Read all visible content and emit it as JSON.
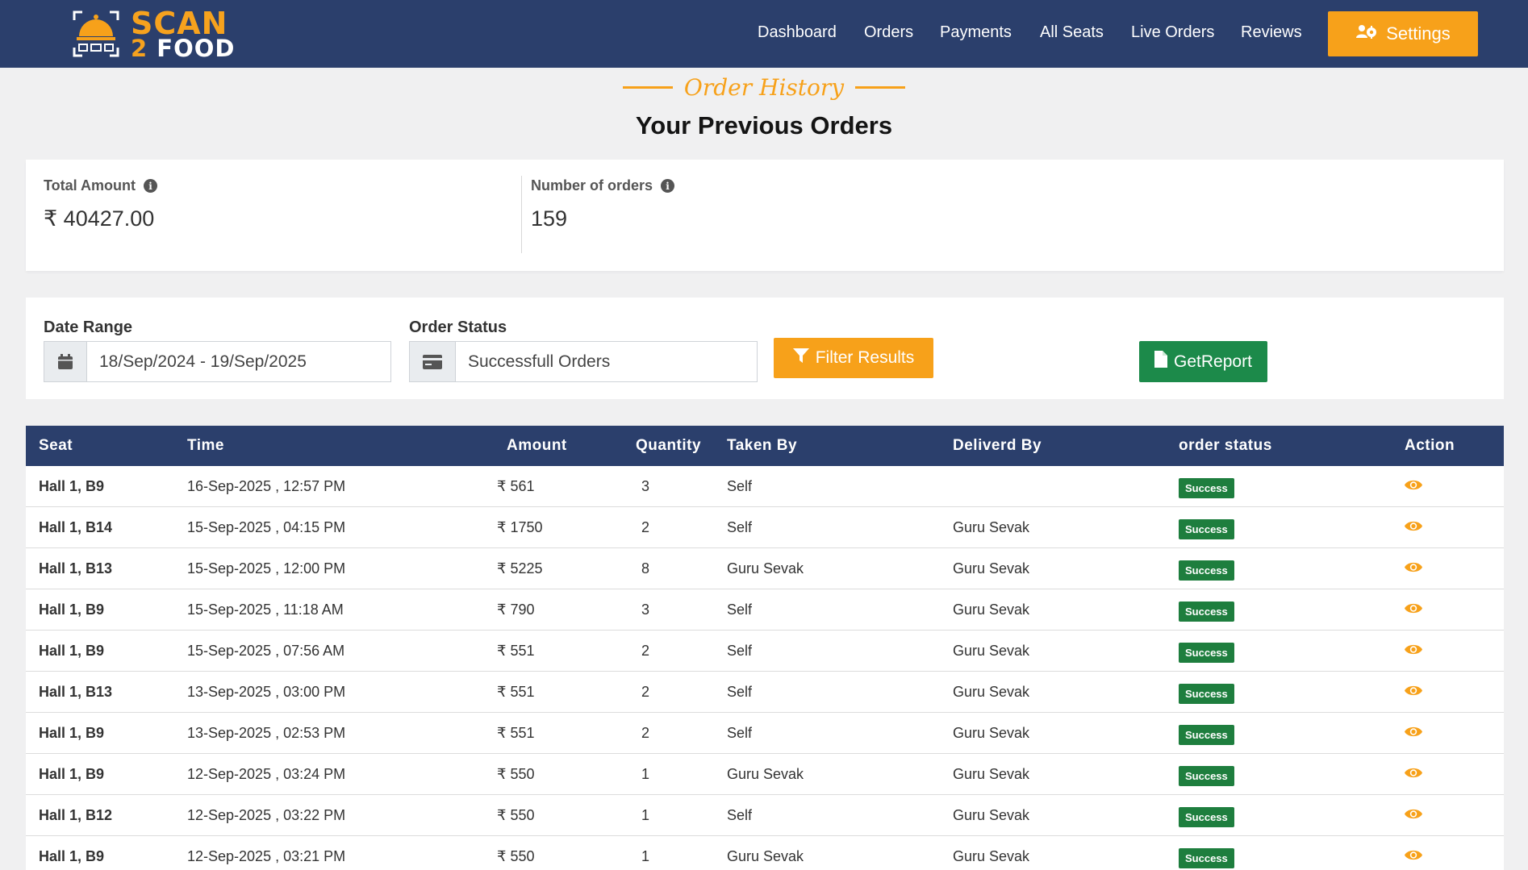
{
  "brand": {
    "line1": "SCAN",
    "line2_num": "2",
    "line2_word": "FOOD"
  },
  "nav": {
    "items": [
      "Dashboard",
      "Orders",
      "Payments",
      "All Seats",
      "Live Orders",
      "Reviews"
    ],
    "settings_label": "Settings"
  },
  "heading": {
    "kicker": "Order History",
    "title": "Your Previous Orders"
  },
  "summary": {
    "total_amount_label": "Total Amount",
    "total_amount_value": "₹ 40427.00",
    "orders_label": "Number of orders",
    "orders_value": "159"
  },
  "filters": {
    "date_label": "Date Range",
    "date_value": "18/Sep/2024 - 19/Sep/2025",
    "status_label": "Order Status",
    "status_value": "Successfull Orders",
    "filter_button": "Filter Results",
    "report_button": "GetReport"
  },
  "table": {
    "headers": [
      "Seat",
      "Time",
      "Amount",
      "Quantity",
      "Taken By",
      "Deliverd By",
      "order status",
      "Action"
    ],
    "rows": [
      {
        "seat": "Hall 1, B9",
        "time": "16-Sep-2025 , 12:57 PM",
        "amount": "₹ 561",
        "qty": "3",
        "taken": "Self",
        "delivered": "",
        "status": "Success"
      },
      {
        "seat": "Hall 1, B14",
        "time": "15-Sep-2025 , 04:15 PM",
        "amount": "₹ 1750",
        "qty": "2",
        "taken": "Self",
        "delivered": "Guru Sevak",
        "status": "Success"
      },
      {
        "seat": "Hall 1, B13",
        "time": "15-Sep-2025 , 12:00 PM",
        "amount": "₹ 5225",
        "qty": "8",
        "taken": "Guru Sevak",
        "delivered": "Guru Sevak",
        "status": "Success"
      },
      {
        "seat": "Hall 1, B9",
        "time": "15-Sep-2025 , 11:18 AM",
        "amount": "₹ 790",
        "qty": "3",
        "taken": "Self",
        "delivered": "Guru Sevak",
        "status": "Success"
      },
      {
        "seat": "Hall 1, B9",
        "time": "15-Sep-2025 , 07:56 AM",
        "amount": "₹ 551",
        "qty": "2",
        "taken": "Self",
        "delivered": "Guru Sevak",
        "status": "Success"
      },
      {
        "seat": "Hall 1, B13",
        "time": "13-Sep-2025 , 03:00 PM",
        "amount": "₹ 551",
        "qty": "2",
        "taken": "Self",
        "delivered": "Guru Sevak",
        "status": "Success"
      },
      {
        "seat": "Hall 1, B9",
        "time": "13-Sep-2025 , 02:53 PM",
        "amount": "₹ 551",
        "qty": "2",
        "taken": "Self",
        "delivered": "Guru Sevak",
        "status": "Success"
      },
      {
        "seat": "Hall 1, B9",
        "time": "12-Sep-2025 , 03:24 PM",
        "amount": "₹ 550",
        "qty": "1",
        "taken": "Guru Sevak",
        "delivered": "Guru Sevak",
        "status": "Success"
      },
      {
        "seat": "Hall 1, B12",
        "time": "12-Sep-2025 , 03:22 PM",
        "amount": "₹ 550",
        "qty": "1",
        "taken": "Self",
        "delivered": "Guru Sevak",
        "status": "Success"
      },
      {
        "seat": "Hall 1, B9",
        "time": "12-Sep-2025 , 03:21 PM",
        "amount": "₹ 550",
        "qty": "1",
        "taken": "Guru Sevak",
        "delivered": "Guru Sevak",
        "status": "Success"
      }
    ]
  },
  "colors": {
    "header_bg": "#2b3f6c",
    "accent": "#f7a11a",
    "success": "#1e7e3e",
    "report": "#1c8a4a"
  },
  "icons": {
    "settings": "users-cog-icon",
    "info": "info-icon",
    "calendar": "calendar-icon",
    "card": "credit-card-icon",
    "filter": "filter-icon",
    "file": "file-icon",
    "view": "eye-icon"
  }
}
